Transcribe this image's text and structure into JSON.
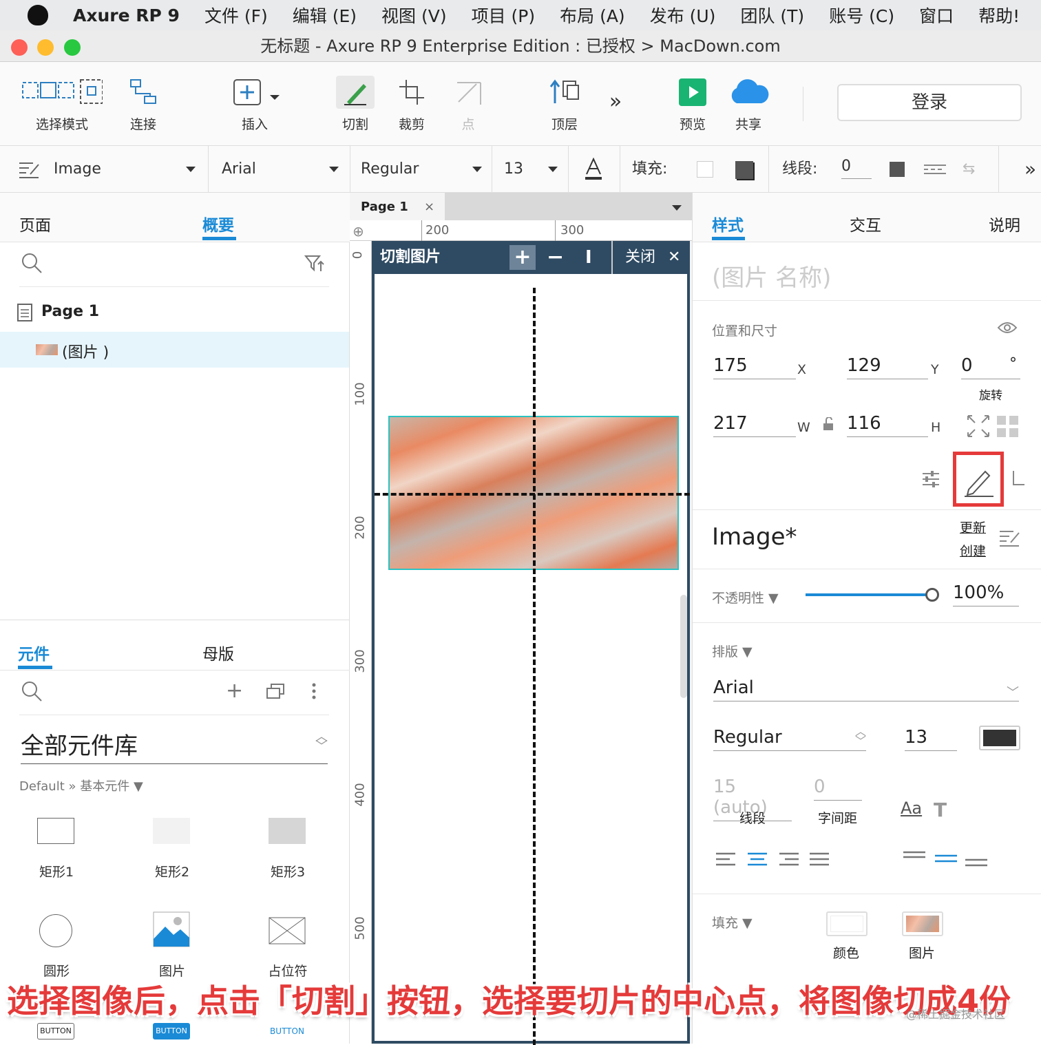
{
  "menubar": {
    "app": "Axure RP 9",
    "items": [
      "文件 (F)",
      "编辑 (E)",
      "视图 (V)",
      "项目 (P)",
      "布局 (A)",
      "发布 (U)",
      "团队 (T)",
      "账号 (C)",
      "窗口",
      "帮助!"
    ]
  },
  "window": {
    "title": "无标题 - Axure RP 9 Enterprise Edition : 已授权 > MacDown.com"
  },
  "toolbar": {
    "select_mode": "选择模式",
    "connect": "连接",
    "insert": "插入",
    "slice": "切割",
    "crop": "裁剪",
    "point": "点",
    "top": "顶层",
    "preview": "预览",
    "share": "共享",
    "login": "登录"
  },
  "format": {
    "style": "Image",
    "font": "Arial",
    "weight": "Regular",
    "size": "13",
    "fill_label": "填充:",
    "stroke_label": "线段:",
    "stroke_value": "0"
  },
  "left": {
    "tab_pages": "页面",
    "tab_outline": "概要",
    "page_name": "Page 1",
    "outline_item": "(图片 )",
    "tab_widgets": "元件",
    "tab_masters": "母版",
    "library": "全部元件库",
    "library_path": "Default » 基本元件 ▼",
    "widgets": [
      "矩形1",
      "矩形2",
      "矩形3",
      "圆形",
      "图片",
      "占位符"
    ],
    "buttons": [
      "BUTTON",
      "BUTTON",
      "BUTTON"
    ]
  },
  "canvas": {
    "tab": "Page 1",
    "ruler_h": [
      "200",
      "300"
    ],
    "ruler_v": [
      "0",
      "100",
      "200",
      "300",
      "400",
      "500"
    ],
    "slice_title": "切割图片",
    "close": "关闭"
  },
  "right": {
    "tab_style": "样式",
    "tab_interact": "交互",
    "tab_notes": "说明",
    "name_placeholder": "(图片 名称)",
    "pos_label": "位置和尺寸",
    "x": "175",
    "x_label": "X",
    "y": "129",
    "y_label": "Y",
    "rot": "0",
    "rot_unit": "°",
    "rot_label": "旋转",
    "w": "217",
    "w_label": "W",
    "h": "116",
    "h_label": "H",
    "style_name": "Image*",
    "update": "更新",
    "create": "创建",
    "opacity_label": "不透明性 ▼",
    "opacity": "100%",
    "typo_label": "排版 ▼",
    "font": "Arial",
    "weight": "Regular",
    "size": "13",
    "line_height": "15 (auto)",
    "letter_spacing": "0",
    "lh_label": "线段",
    "ls_label": "字间距",
    "fill_label": "填充 ▼",
    "fill_color": "颜色",
    "fill_image": "图片"
  },
  "banner": "选择图像后，点击「切割」按钮，选择要切片的中心点，将图像切成4份",
  "watermark": "@稀土掘金技术社区",
  "colors": {
    "accent": "#1a8ad6",
    "highlight": "#e53a3a",
    "slice_header": "#2f4b63"
  }
}
